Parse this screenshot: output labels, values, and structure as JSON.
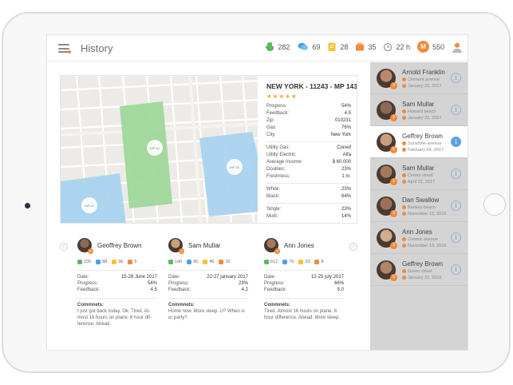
{
  "header": {
    "title": "History",
    "stats": [
      {
        "icon": "hand-icon",
        "value": "282",
        "color": "#5cb85c"
      },
      {
        "icon": "chat-icon",
        "value": "69",
        "color": "#4aa3df"
      },
      {
        "icon": "note-icon",
        "value": "28",
        "color": "#f3c13a"
      },
      {
        "icon": "wallet-icon",
        "value": "35",
        "color": "#f08a3c"
      },
      {
        "icon": "clock-icon",
        "value": "22 h",
        "color": "#9a9a9a"
      },
      {
        "icon": "coin-icon",
        "value": "550",
        "badge": "M",
        "color": "#f08a3c"
      }
    ]
  },
  "location": {
    "title": "NEW YORK - 11243 - MP 143",
    "rating": 5,
    "rows_a": [
      {
        "label": "Progress:",
        "value": "54%"
      },
      {
        "label": "Feedback:",
        "value": "4.5"
      },
      {
        "label": "Zip:",
        "value": "010231"
      },
      {
        "label": "Gas:",
        "value": "76%"
      },
      {
        "label": "City",
        "value": "New York"
      }
    ],
    "rows_b": [
      {
        "label": "Utility Gas:",
        "value": "Coned"
      },
      {
        "label": "Utility Electric:",
        "value": "Alfa"
      },
      {
        "label": "Average Income:",
        "value": "$ 60.000"
      },
      {
        "label": "Doubles:",
        "value": "23%"
      },
      {
        "label": "Freshness:",
        "value": "1 m."
      }
    ],
    "rows_c": [
      {
        "label": "White:",
        "value": "23%"
      },
      {
        "label": "Black:",
        "value": "64%"
      }
    ],
    "rows_d": [
      {
        "label": "Single:",
        "value": "23%"
      },
      {
        "label": "Multi:",
        "value": "14%"
      }
    ],
    "map_labels": {
      "zone_a": "MP 45",
      "zone_b": "MP 12",
      "zone_c": "MP 33"
    }
  },
  "cards": [
    {
      "name": "Geoffrey Brown",
      "badge": "5",
      "stats": [
        "235",
        "88",
        "36",
        "5"
      ],
      "date": "15-28 June 2017",
      "progress": "54%",
      "feedback": "4.5",
      "comment": "I just got back today. Ok. Tired. Al-most 16 hours on plane. 6 hour dif-ference. Ahead."
    },
    {
      "name": "Sam Mullar",
      "badge": "2",
      "stats": [
        "140",
        "95",
        "46",
        "10"
      ],
      "date": "22-27 january 2017",
      "progress": "23%",
      "feedback": "4.2",
      "comment": "Home now. More sleep. U? When is ur party?"
    },
    {
      "name": "Ann Jones",
      "badge": "2",
      "stats": [
        "612",
        "76",
        "23",
        "8"
      ],
      "date": "12-25 july 2017",
      "progress": "66%",
      "feedback": "5.0",
      "comment": "Tired. Almost 16 hours on plane. 6 hour difference. Ahead. More sleep."
    }
  ],
  "card_labels": {
    "date": "Date:",
    "progress": "Progress:",
    "feedback": "Feedback:",
    "comments": "Commnets:"
  },
  "sidebar": {
    "items": [
      {
        "name": "Arnold Franklin",
        "badge": "3",
        "place": "Clement avenue",
        "date": "January 23, 2017",
        "active": false
      },
      {
        "name": "Sam Mullar",
        "badge": "2",
        "place": "Howard beach",
        "date": "January 22, 2017",
        "active": false
      },
      {
        "name": "Geffrey Brown",
        "badge": "5",
        "place": "Sunshine avenue",
        "date": "February 04, 2017",
        "active": true
      },
      {
        "name": "Sam Mullar",
        "badge": "2",
        "place": "Center street",
        "date": "April 12, 2017",
        "active": false
      },
      {
        "name": "Dan Swallow",
        "badge": "3",
        "place": "Bankey beach",
        "date": "November 13, 2016",
        "active": false
      },
      {
        "name": "Ann Jones",
        "badge": "2",
        "place": "Cosmic avenue",
        "date": "November 13, 2016",
        "active": false
      },
      {
        "name": "Geffrey Brown",
        "badge": "5",
        "place": "Green street",
        "date": "January 22, 2015",
        "active": false
      }
    ]
  },
  "colors": {
    "accent": "#f08a3c",
    "info": "#5aa3e0",
    "map_green": "#9fd89a",
    "map_blue": "#aad3ee"
  }
}
